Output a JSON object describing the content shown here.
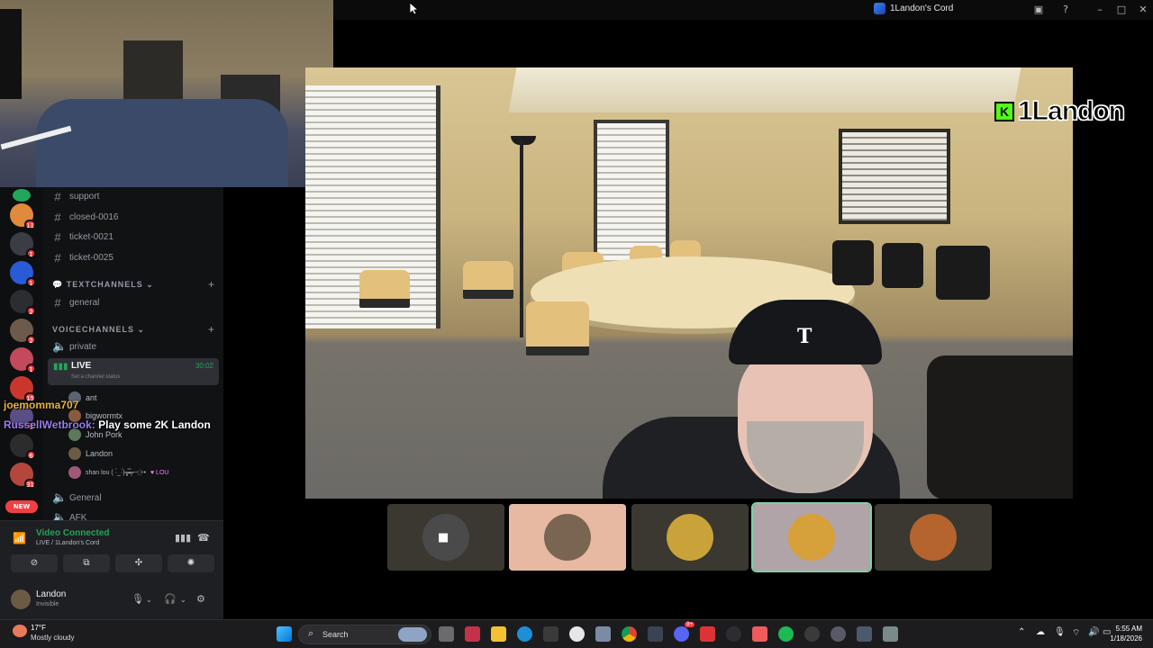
{
  "window": {
    "title": "1Landon's Cord",
    "controls": [
      "minimize-icon",
      "maximize-icon",
      "close-icon"
    ]
  },
  "servers": {
    "badges": [
      "11",
      "1",
      "1",
      "2",
      "2",
      "1",
      "15",
      "4",
      "6",
      "31"
    ],
    "new_label": "NEW"
  },
  "channels": {
    "text_top": [
      "support",
      "closed-0016",
      "ticket-0021",
      "ticket-0025"
    ],
    "text_category": "TEXTCHANNELS",
    "text_items": [
      "general"
    ],
    "voice_category": "VOICECHANNELS",
    "voice_items": [
      "private"
    ],
    "live": {
      "name": "LIVE",
      "status": "Set a channel status",
      "time": "30:02"
    },
    "members": [
      "ant",
      "bigwormtx",
      "John Pork",
      "Landon",
      "shan lou ( ·̀_·́)╦̵̵̿╤─ ҉~•",
      "LOU"
    ],
    "after_items": [
      "General",
      "AFK"
    ]
  },
  "chat": {
    "line1_user": "joemomma707",
    "line2_user": "RussellWetbrook:",
    "line2_msg": "Play some 2K Landon"
  },
  "voice_panel": {
    "title": "Video Connected",
    "subtitle": "LIVE / 1Landon's Cord"
  },
  "user": {
    "name": "Landon",
    "status": "Invisible"
  },
  "overlay": {
    "badge": "K",
    "name": "1Landon"
  },
  "stage": {
    "cap_letter": "T"
  },
  "taskbar": {
    "weather_temp": "17°F",
    "weather_desc": "Mostly cloudy",
    "search_placeholder": "Search",
    "time": "5:55 AM",
    "date": "1/18/2026",
    "discord_badge": "9+"
  },
  "colors": {
    "discord_green": "#23a55a",
    "kick_green": "#53fc18",
    "accent_red": "#f23f43"
  }
}
